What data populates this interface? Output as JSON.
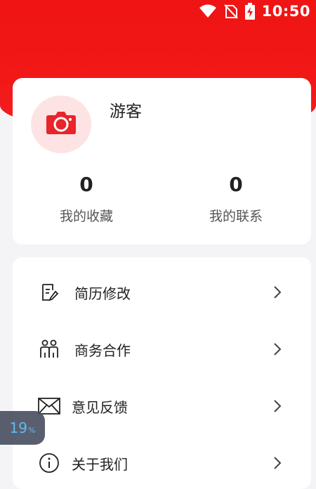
{
  "status_bar": {
    "time": "10:50",
    "icons": [
      "wifi-icon",
      "no-sim-icon",
      "battery-charging-icon"
    ]
  },
  "profile": {
    "username": "游客",
    "avatar_icon": "camera-icon",
    "stats": [
      {
        "value": "0",
        "label": "我的收藏"
      },
      {
        "value": "0",
        "label": "我的联系"
      }
    ]
  },
  "menu": {
    "items": [
      {
        "label": "简历修改",
        "icon": "resume-edit-icon"
      },
      {
        "label": "商务合作",
        "icon": "people-icon"
      },
      {
        "label": "意见反馈",
        "icon": "mail-icon"
      },
      {
        "label": "关于我们",
        "icon": "info-icon"
      }
    ]
  },
  "floating_badge": {
    "value": "19",
    "unit": "%"
  },
  "colors": {
    "brand_red": "#f01414",
    "avatar_bg": "#fde3e3",
    "badge_bg": "#4b5262",
    "badge_text": "#4fb6f5"
  }
}
